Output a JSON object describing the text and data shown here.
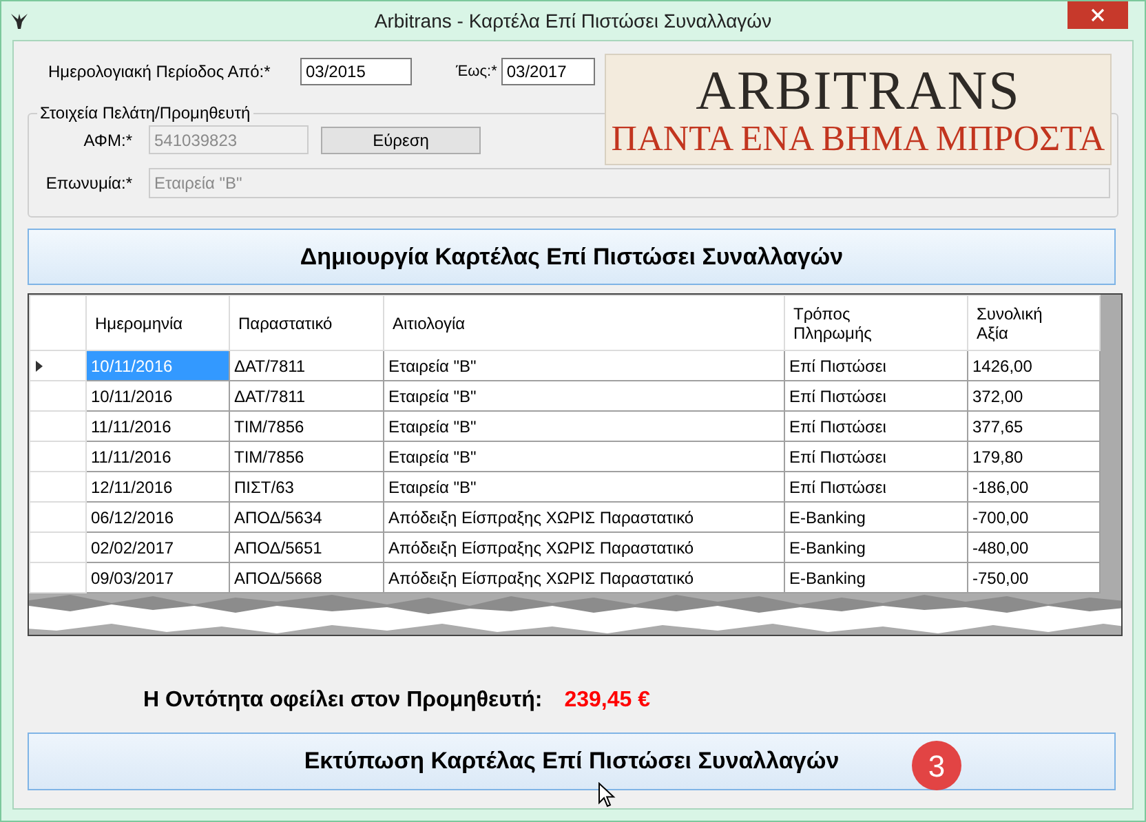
{
  "window": {
    "title": "Arbitrans - Καρτέλα Επί Πιστώσει Συναλλαγών"
  },
  "period": {
    "from_label": "Ημερολογιακή Περίοδος Από:*",
    "from_value": "03/2015",
    "to_label": "Έως:*",
    "to_value": "03/2017"
  },
  "logo": {
    "name": "ARBITRANS",
    "slogan": "ΠΑΝΤΑ ΕΝΑ ΒΗΜΑ ΜΠΡΟΣΤΑ"
  },
  "customer_group": {
    "title": "Στοιχεία Πελάτη/Προμηθευτή",
    "vat_label": "ΑΦΜ:*",
    "vat_value": "541039823",
    "find_button": "Εύρεση",
    "name_label": "Επωνυμία:*",
    "name_value": "Εταιρεία \"Β\""
  },
  "create_button": "Δημιουργία Καρτέλας Επί Πιστώσει Συναλλαγών",
  "table": {
    "columns": [
      "Ημερομηνία",
      "Παραστατικό",
      "Αιτιολογία",
      "Τρόπος Πληρωμής",
      "Συνολική Αξία"
    ],
    "rows": [
      {
        "cells": [
          "10/11/2016",
          "ΔΑΤ/7811",
          "Εταιρεία \"Β\"",
          "Επί Πιστώσει",
          "1426,00"
        ],
        "selected": true
      },
      {
        "cells": [
          "10/11/2016",
          "ΔΑΤ/7811",
          "Εταιρεία \"Β\"",
          "Επί Πιστώσει",
          "372,00"
        ],
        "selected": false
      },
      {
        "cells": [
          "11/11/2016",
          "ΤΙΜ/7856",
          "Εταιρεία \"Β\"",
          "Επί Πιστώσει",
          "377,65"
        ],
        "selected": false
      },
      {
        "cells": [
          "11/11/2016",
          "ΤΙΜ/7856",
          "Εταιρεία \"Β\"",
          "Επί Πιστώσει",
          "179,80"
        ],
        "selected": false
      },
      {
        "cells": [
          "12/11/2016",
          "ΠΙΣΤ/63",
          "Εταιρεία \"Β\"",
          "Επί Πιστώσει",
          "-186,00"
        ],
        "selected": false
      },
      {
        "cells": [
          "06/12/2016",
          "ΑΠΟΔ/5634",
          "Απόδειξη Είσπραξης ΧΩΡΙΣ Παραστατικό",
          "E-Banking",
          "-700,00"
        ],
        "selected": false
      },
      {
        "cells": [
          "02/02/2017",
          "ΑΠΟΔ/5651",
          "Απόδειξη Είσπραξης ΧΩΡΙΣ Παραστατικό",
          "E-Banking",
          "-480,00"
        ],
        "selected": false
      },
      {
        "cells": [
          "09/03/2017",
          "ΑΠΟΔ/5668",
          "Απόδειξη Είσπραξης ΧΩΡΙΣ Παραστατικό",
          "E-Banking",
          "-750,00"
        ],
        "selected": false
      }
    ]
  },
  "summary": {
    "label": "Η Οντότητα οφείλει στον Προμηθευτή:",
    "value": "239,45 €"
  },
  "print_button": "Εκτύπωση Καρτέλας Επί Πιστώσει Συναλλαγών",
  "step_badge": "3"
}
